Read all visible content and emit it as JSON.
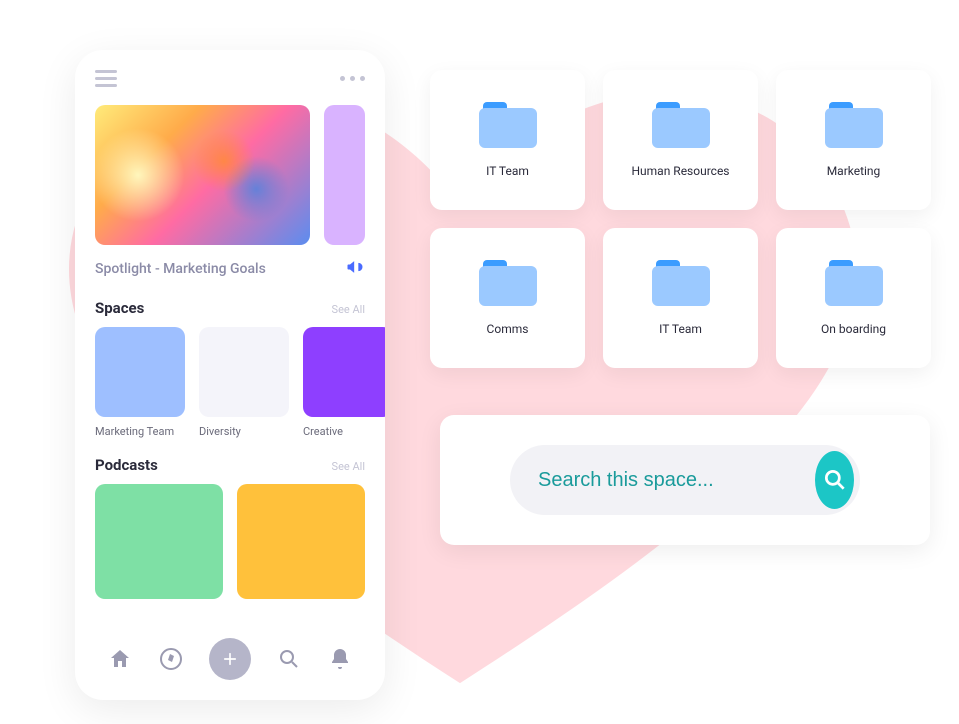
{
  "phone": {
    "spotlight_label": "Spotlight - Marketing Goals",
    "sections": {
      "spaces": {
        "title": "Spaces",
        "see_all": "See All"
      },
      "podcasts": {
        "title": "Podcasts",
        "see_all": "See All"
      }
    },
    "spaces": [
      {
        "label": "Marketing Team",
        "color": "tile-blue"
      },
      {
        "label": "Diversity",
        "color": "tile-light"
      },
      {
        "label": "Creative",
        "color": "tile-purple"
      }
    ]
  },
  "folders": [
    {
      "label": "IT Team"
    },
    {
      "label": "Human Resources"
    },
    {
      "label": "Marketing"
    },
    {
      "label": "Comms"
    },
    {
      "label": "IT Team"
    },
    {
      "label": "On boarding"
    }
  ],
  "search": {
    "placeholder": "Search this space..."
  }
}
